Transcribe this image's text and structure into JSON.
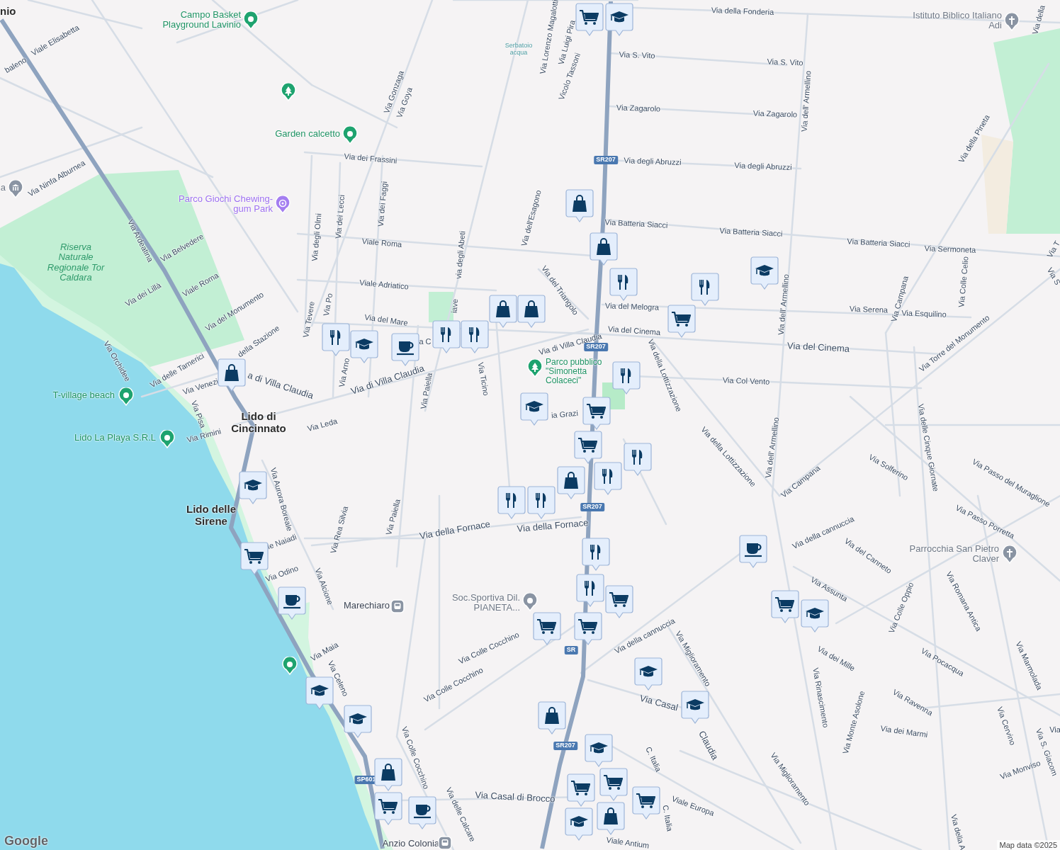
{
  "map": {
    "towns": [
      {
        "name": "nio"
      },
      {
        "name": "Lido di Cincinnato"
      },
      {
        "name": "Lido delle Sirene"
      }
    ],
    "places": [
      {
        "name": "Campo Basket Playground Lavinio",
        "kind": "sport"
      },
      {
        "name": "Garden calcetto",
        "kind": "sport"
      },
      {
        "name": "Parco Giochi Chewing-gum Park",
        "kind": "play"
      },
      {
        "name": "Riserva Naturale Regionale Tor Caldara",
        "kind": "reserve"
      },
      {
        "name": "T-village beach",
        "kind": "sport"
      },
      {
        "name": "Lido La Playa S.R.L",
        "kind": "sport"
      },
      {
        "name": "Parco pubblico \"Simonetta Colaceci\"",
        "kind": "park"
      },
      {
        "name": "Istituto Biblico Italiano Adi",
        "kind": "worship"
      },
      {
        "name": "Parrocchia San Pietro Claver",
        "kind": "worship"
      },
      {
        "name": "Soc.Sportiva Dil. PIANETA...",
        "kind": "poi"
      },
      {
        "name": "Serbatoio acqua",
        "kind": "water"
      },
      {
        "name": "Marechiaro",
        "kind": "station"
      },
      {
        "name": "Anzio Colonia",
        "kind": "station"
      },
      {
        "name": "a",
        "kind": "museum"
      }
    ],
    "pins": [
      {
        "kind": "park"
      },
      {
        "kind": "sport"
      }
    ],
    "streets": [
      "Via della Fonderia",
      "Via S. Vito",
      "Via S. Vito",
      "Via Zagarolo",
      "Via Zagarolo",
      "Via degli Abruzzi",
      "Via degli Abruzzi",
      "Via Batteria Siacci",
      "Via Batteria Siacci",
      "Via Batteria Siacci",
      "Via Sermoneta",
      "Via del Melogra",
      "Via del Cinema",
      "Via del Cinema",
      "Via Serena",
      "Via Esquilino",
      "Via Col Vento",
      "Via dell' Armellino",
      "Via dell' Armellino",
      "Via dell' Armellino",
      "Via della Pineta",
      "Via Campana",
      "Via Colle Celio",
      "Via Torre del Monumento",
      "Via della Lottizzazione",
      "Via della Lottizzazione",
      "Via Campana",
      "Via Solferino",
      "Via delle Cinque Giornate",
      "Via Passo del Muraglione",
      "Via Passo Porretta",
      "Via della cannuccia",
      "Via del Canneto",
      "Via Assunta",
      "Via Colle Oppio",
      "Via Romana Antica",
      "Via dei Mille",
      "Via Pocacqua",
      "Via Rinascimento",
      "Via Miglioramento",
      "Via Casal",
      "Claudia",
      "Via Marmolada",
      "Via Ravenna",
      "Via dei Marmi",
      "Via Monte Asolone",
      "Via Cervino",
      "Via S. Giacom",
      "Via Monviso",
      "Via Miglioramento",
      "Viale Europa",
      "C. Italia",
      "C. Italia",
      "Viale Antium",
      "Via della A",
      "Via Casal di Brocco",
      "Via delle Calcare",
      "Via Colle Cocchino",
      "Via Colle Cocchino",
      "Via Colle Cocchino",
      "Via della cannuccia",
      "Via della Fornace",
      "Via della Fornace",
      "Via Paiella",
      "Via Rea Silvia",
      "Via Alcione",
      "Via Odino",
      "le Naiadi",
      "Via Aurora Boreale",
      "Via Maia",
      "Via Celeno",
      "Via Rimini",
      "Via Leda",
      "Via Pisa",
      "Via Venezi",
      "Via delle Tamerici",
      "Via Orchidee",
      "a di Villa Claudia",
      "Via di Villa Claudia",
      "Via di Villa Claudia",
      "della Stazione",
      "Via del Monumento",
      "Viale Roma",
      "Via dei Lillà",
      "Via Belvedere",
      "Via Ardeatina",
      "Via Ninfa Alburnea",
      "Viale Elisabetta",
      "baleno",
      "Via Tevere",
      "Via Po",
      "Via Arno",
      "Via del Mare",
      "a C",
      "Via degli Olmi",
      "Via dei Lecci",
      "Via dei Faggi",
      "via degli Abeti",
      "iave",
      "Viale Roma",
      "Viale Adriatico",
      "Via dei Frassini",
      "Via Gonzaga",
      "Via Goya",
      "Via dell'Esagono",
      "Via Lorenzo Magalotti",
      "Via Luigi Pira",
      "Vicolo Tassoni",
      "Via del Triangolo",
      "Via Ticino",
      "Via Paiella",
      "ia Grazi",
      "Via della",
      "Via T",
      "Via S",
      "Via"
    ],
    "shields": [
      "SR207",
      "SR207",
      "SR207",
      "SR207",
      "SP601",
      "SR"
    ],
    "markers": [
      {
        "kind": "grocery"
      },
      {
        "kind": "school"
      },
      {
        "kind": "shop"
      },
      {
        "kind": "shop"
      },
      {
        "kind": "food"
      },
      {
        "kind": "food"
      },
      {
        "kind": "school"
      },
      {
        "kind": "grocery"
      },
      {
        "kind": "food"
      },
      {
        "kind": "school"
      },
      {
        "kind": "food"
      },
      {
        "kind": "food"
      },
      {
        "kind": "shop"
      },
      {
        "kind": "shop"
      },
      {
        "kind": "cafe"
      },
      {
        "kind": "shop"
      },
      {
        "kind": "food"
      },
      {
        "kind": "grocery"
      },
      {
        "kind": "school"
      },
      {
        "kind": "grocery"
      },
      {
        "kind": "food"
      },
      {
        "kind": "school"
      },
      {
        "kind": "food"
      },
      {
        "kind": "shop"
      },
      {
        "kind": "food"
      },
      {
        "kind": "food"
      },
      {
        "kind": "grocery"
      },
      {
        "kind": "food"
      },
      {
        "kind": "cafe"
      },
      {
        "kind": "food"
      },
      {
        "kind": "cafe"
      },
      {
        "kind": "grocery"
      },
      {
        "kind": "grocery"
      },
      {
        "kind": "school"
      },
      {
        "kind": "grocery"
      },
      {
        "kind": "grocery"
      },
      {
        "kind": "school"
      },
      {
        "kind": "school"
      },
      {
        "kind": "school"
      },
      {
        "kind": "shop"
      },
      {
        "kind": "school"
      },
      {
        "kind": "shop"
      },
      {
        "kind": "grocery"
      },
      {
        "kind": "school"
      },
      {
        "kind": "grocery"
      },
      {
        "kind": "grocery"
      },
      {
        "kind": "grocery"
      },
      {
        "kind": "school"
      },
      {
        "kind": "shop"
      },
      {
        "kind": "cafe"
      }
    ],
    "logo": "Google",
    "attribution": "Map data ©2025"
  }
}
